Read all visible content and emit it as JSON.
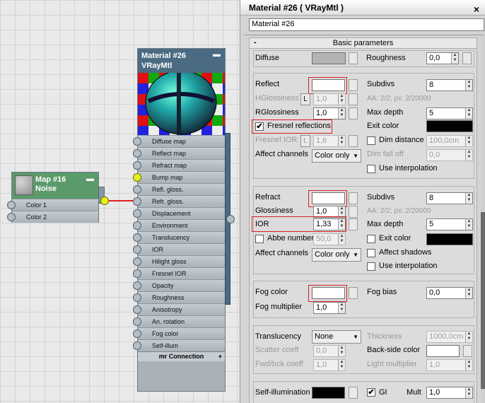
{
  "node_editor": {
    "noise_node": {
      "title_line1": "Map #16",
      "title_line2": "Noise",
      "slots": [
        "Color 1",
        "Color 2"
      ]
    },
    "material_node": {
      "title_line1": "Material #26",
      "title_line2": "VRayMtl",
      "slots": [
        "Diffuse map",
        "Reflect map",
        "Refract map",
        "Bump map",
        "Refl. gloss.",
        "Refr. gloss.",
        "Displacement",
        "Environment",
        "Translucency",
        "IOR",
        "Hilight gloss",
        "Fresnel IOR",
        "Opacity",
        "Roughness",
        "Anisotropy",
        "An. rotation",
        "Fog color",
        "Self-illum"
      ],
      "footer": "mr Connection",
      "footer_plus": "+"
    }
  },
  "panel": {
    "title": "Material #26  ( VRayMtl )",
    "close": "×",
    "material_name": "Material #26",
    "rollout_minus": "-",
    "rollout_title": "Basic parameters",
    "diffuse": {
      "label": "Diffuse",
      "roughness_label": "Roughness",
      "roughness": "0,0",
      "color": "#b4b4b4"
    },
    "reflect": {
      "label": "Reflect",
      "color": "#ffffff",
      "subdivs_label": "Subdivs",
      "subdivs": "8",
      "aa_text": "AA: 2/2; px: 2/20000",
      "hgloss_label": "HGlossiness",
      "hgloss": "1,0",
      "rgloss_label": "RGlossiness",
      "rgloss": "1,0",
      "lock": "L",
      "max_depth_label": "Max depth",
      "max_depth": "5",
      "fresnel_label": "Fresnel reflections",
      "fresnel_checked": "✔",
      "exit_color_label": "Exit color",
      "exit_color": "#000000",
      "fresnel_ior_label": "Fresnel IOR",
      "fresnel_ior": "1,6",
      "dim_distance_label": "Dim distance",
      "dim_distance": "100,0cm",
      "dim_falloff_label": "Dim fall off",
      "dim_falloff": "0,0",
      "affect_channels_label": "Affect channels",
      "affect_channels": "Color only",
      "use_interp_label": "Use interpolation"
    },
    "refract": {
      "label": "Refract",
      "color": "#ffffff",
      "subdivs_label": "Subdivs",
      "subdivs": "8",
      "aa_text": "AA: 2/2; px: 2/20000",
      "gloss_label": "Glossiness",
      "gloss": "1,0",
      "ior_label": "IOR",
      "ior": "1,33",
      "max_depth_label": "Max depth",
      "max_depth": "5",
      "abbe_label": "Abbe number",
      "abbe": "50,0",
      "exit_color_label": "Exit color",
      "exit_color": "#000000",
      "affect_channels_label": "Affect channels",
      "affect_channels": "Color only",
      "affect_shadows_label": "Affect shadows",
      "use_interp_label": "Use interpolation"
    },
    "fog": {
      "color_label": "Fog color",
      "color": "#ffffff",
      "bias_label": "Fog bias",
      "bias": "0,0",
      "mult_label": "Fog multiplier",
      "mult": "1,0"
    },
    "translucency": {
      "label": "Translucency",
      "mode": "None",
      "thickness_label": "Thickness",
      "thickness": "1000,0cm",
      "scatter_label": "Scatter coeff",
      "scatter": "0,0",
      "backside_label": "Back-side color",
      "backside_color": "#ffffff",
      "fwd_label": "Fwd/bck coeff",
      "fwd": "1,0",
      "light_mult_label": "Light multiplier",
      "light_mult": "1,0"
    },
    "selfillum": {
      "label": "Self-illumination",
      "color": "#000000",
      "gi_label": "GI",
      "gi_checked": "✔",
      "mult_label": "Mult",
      "mult": "1,0"
    }
  },
  "colors": {
    "highlight_red": "#d82020",
    "node_header": "#4b6b82",
    "noise_header": "#5b9a6a",
    "wire": "#e41e1e"
  }
}
